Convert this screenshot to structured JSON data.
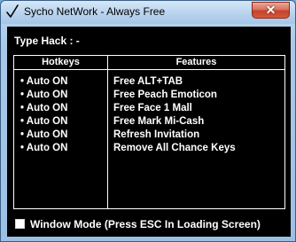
{
  "window": {
    "title": "Sycho NetWork - Always Free",
    "close_symbol": "✕"
  },
  "content": {
    "type_hack_label": "Type Hack  : -",
    "table": {
      "headers": [
        "Hotkeys",
        "Features"
      ],
      "rows": [
        {
          "hotkey": "• Auto ON",
          "feature": "Free ALT+TAB"
        },
        {
          "hotkey": "• Auto ON",
          "feature": "Free Peach Emoticon"
        },
        {
          "hotkey": "• Auto ON",
          "feature": "Free Face 1 Mall"
        },
        {
          "hotkey": "• Auto ON",
          "feature": "Free Mark Mi-Cash"
        },
        {
          "hotkey": "• Auto ON",
          "feature": "Refresh Invitation"
        },
        {
          "hotkey": "• Auto ON",
          "feature": "Remove All Chance Keys"
        }
      ]
    },
    "window_mode": {
      "label": "Window Mode (Press ESC  In Loading Screen)",
      "checked": false
    }
  },
  "colors": {
    "client_bg": "#000000",
    "text": "#ffffff",
    "titlebar": "#b8d3ee",
    "close_button": "#c4432a"
  },
  "icons": {
    "app": "checkmark-icon",
    "close": "close-icon"
  }
}
